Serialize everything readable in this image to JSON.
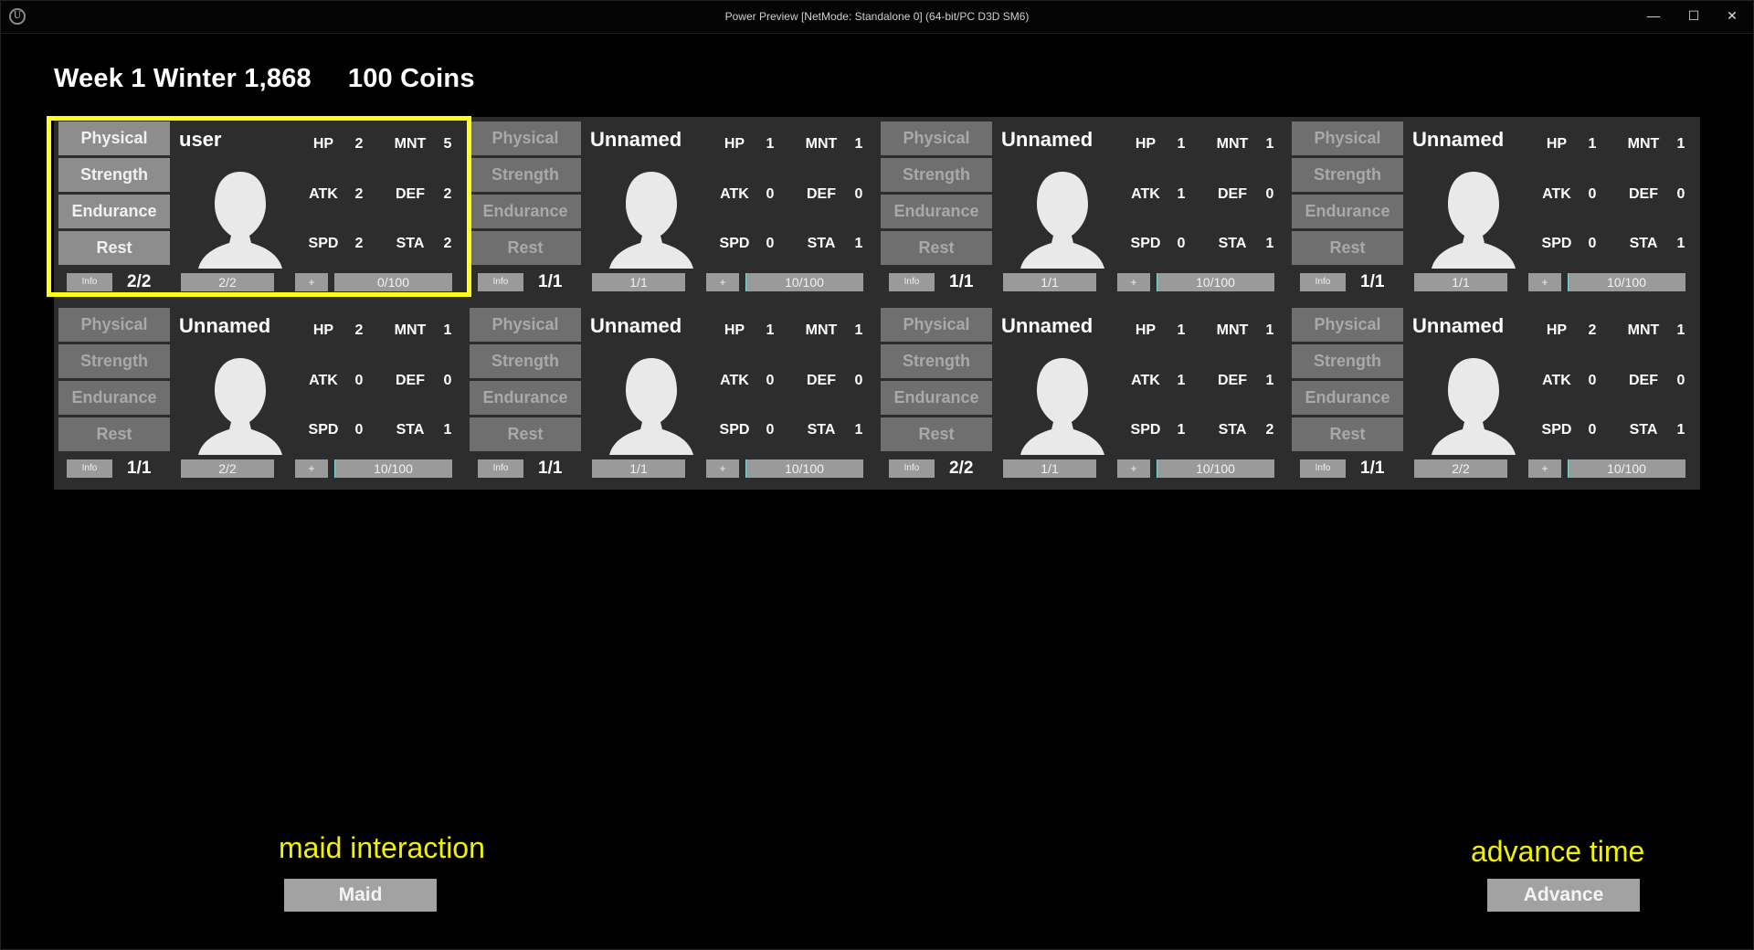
{
  "window": {
    "title": "Power Preview [NetMode: Standalone 0]  (64-bit/PC D3D SM6)",
    "logo_glyph": "U",
    "minimize": "—",
    "maximize": "☐",
    "close": "✕"
  },
  "header": {
    "date": "Week 1 Winter 1,868",
    "coins": "100 Coins"
  },
  "training_buttons": [
    "Physical",
    "Strength",
    "Endurance",
    "Rest"
  ],
  "info_label": "Info",
  "plus_label": "+",
  "colors": {
    "highlight": "#ffff1a",
    "annotation": "#f2f200",
    "progress_fill": "#7fd7d7",
    "panel": "#2d2d2d"
  },
  "characters": [
    {
      "name": "user",
      "hp": "2",
      "mnt": "5",
      "atk": "2",
      "def": "2",
      "spd": "2",
      "sta": "2",
      "count": "2/2",
      "sub": "2/2",
      "progress": "0/100",
      "progress_pct": 0,
      "active": true
    },
    {
      "name": "Unnamed",
      "hp": "1",
      "mnt": "1",
      "atk": "0",
      "def": "0",
      "spd": "0",
      "sta": "1",
      "count": "1/1",
      "sub": "1/1",
      "progress": "10/100",
      "progress_pct": 10,
      "active": false
    },
    {
      "name": "Unnamed",
      "hp": "1",
      "mnt": "1",
      "atk": "1",
      "def": "0",
      "spd": "0",
      "sta": "1",
      "count": "1/1",
      "sub": "1/1",
      "progress": "10/100",
      "progress_pct": 10,
      "active": false
    },
    {
      "name": "Unnamed",
      "hp": "1",
      "mnt": "1",
      "atk": "0",
      "def": "0",
      "spd": "0",
      "sta": "1",
      "count": "1/1",
      "sub": "1/1",
      "progress": "10/100",
      "progress_pct": 10,
      "active": false
    },
    {
      "name": "Unnamed",
      "hp": "2",
      "mnt": "1",
      "atk": "0",
      "def": "0",
      "spd": "0",
      "sta": "1",
      "count": "1/1",
      "sub": "2/2",
      "progress": "10/100",
      "progress_pct": 10,
      "active": false
    },
    {
      "name": "Unnamed",
      "hp": "1",
      "mnt": "1",
      "atk": "0",
      "def": "0",
      "spd": "0",
      "sta": "1",
      "count": "1/1",
      "sub": "1/1",
      "progress": "10/100",
      "progress_pct": 10,
      "active": false
    },
    {
      "name": "Unnamed",
      "hp": "1",
      "mnt": "1",
      "atk": "1",
      "def": "1",
      "spd": "1",
      "sta": "2",
      "count": "2/2",
      "sub": "1/1",
      "progress": "10/100",
      "progress_pct": 10,
      "active": false
    },
    {
      "name": "Unnamed",
      "hp": "2",
      "mnt": "1",
      "atk": "0",
      "def": "0",
      "spd": "0",
      "sta": "1",
      "count": "1/1",
      "sub": "2/2",
      "progress": "10/100",
      "progress_pct": 10,
      "active": false
    }
  ],
  "stat_labels": {
    "hp": "HP",
    "mnt": "MNT",
    "atk": "ATK",
    "def": "DEF",
    "spd": "SPD",
    "sta": "STA"
  },
  "bottom": {
    "maid_annotation": "maid interaction",
    "maid_button": "Maid",
    "advance_annotation": "advance time",
    "advance_button": "Advance"
  }
}
